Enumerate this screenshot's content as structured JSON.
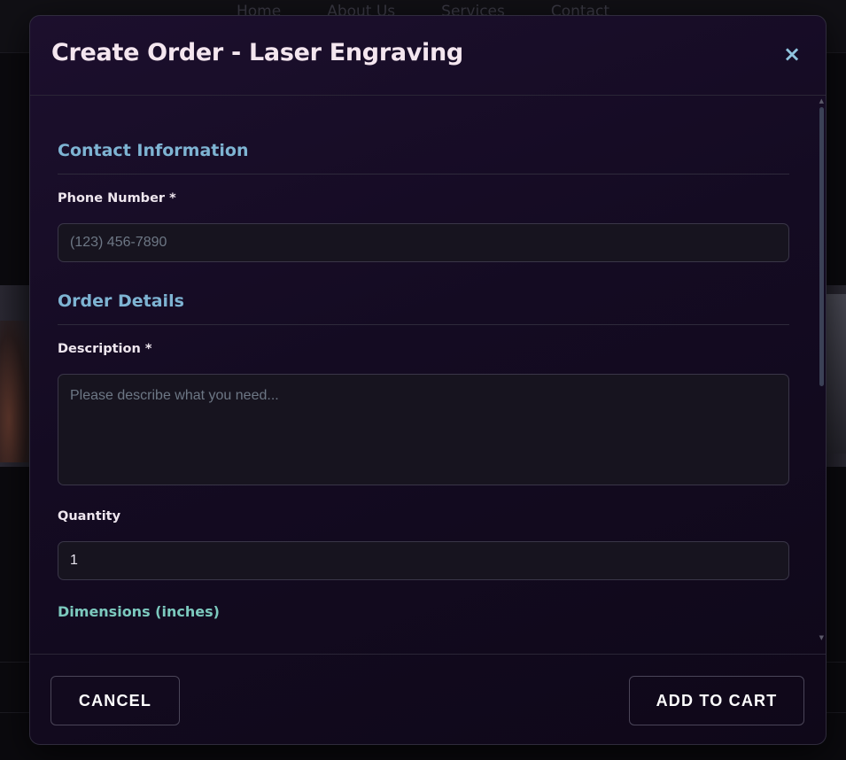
{
  "background": {
    "nav": [
      "Home",
      "About Us",
      "Services",
      "Contact"
    ]
  },
  "modal": {
    "title": "Create Order - Laser Engraving",
    "close_icon": "×",
    "sections": {
      "contact": {
        "title": "Contact Information",
        "phone_label": "Phone Number *",
        "phone_placeholder": "(123) 456-7890",
        "phone_value": ""
      },
      "order": {
        "title": "Order Details",
        "description_label": "Description *",
        "description_placeholder": "Please describe what you need...",
        "description_value": "",
        "quantity_label": "Quantity",
        "quantity_value": "1",
        "dimensions_title": "Dimensions (inches)"
      }
    },
    "footer": {
      "cancel_label": "CANCEL",
      "add_to_cart_label": "ADD TO CART"
    }
  },
  "colors": {
    "accent_section": "#7eb4d3",
    "accent_subsection": "#7cc9be",
    "modal_bg": "#1c0f2d"
  },
  "icons": {
    "close": "close-icon"
  }
}
